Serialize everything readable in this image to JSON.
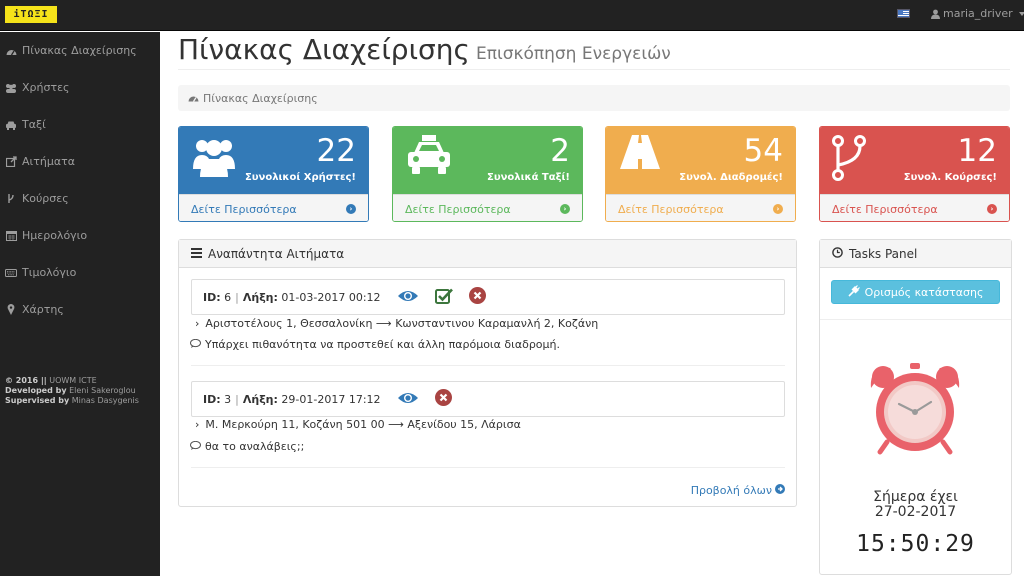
{
  "brand": {
    "logo_text": "iTΩΞI"
  },
  "topbar": {
    "username": "maria_driver"
  },
  "sidebar": {
    "items": [
      {
        "label": "Πίνακας Διαχείρισης",
        "icon": "dashboard-icon"
      },
      {
        "label": "Χρήστες",
        "icon": "users-icon"
      },
      {
        "label": "Ταξί",
        "icon": "taxi-icon"
      },
      {
        "label": "Αιτήματα",
        "icon": "external-link-icon"
      },
      {
        "label": "Κούρσες",
        "icon": "fork-icon"
      },
      {
        "label": "Ημερολόγιο",
        "icon": "calendar-icon"
      },
      {
        "label": "Τιμολόγιο",
        "icon": "keyboard-icon"
      },
      {
        "label": "Χάρτης",
        "icon": "map-marker-icon"
      }
    ],
    "footer": {
      "copyright": "© 2016 ||",
      "org": "UOWM ICTE",
      "developed_label": "Developed by",
      "developer": "Eleni Sakeroglou",
      "supervised_label": "Supervised by",
      "supervisor": "Minas Dasygenis"
    }
  },
  "header": {
    "title": "Πίνακας Διαχείρισης",
    "subtitle": "Επισκόπηση Ενεργειών"
  },
  "breadcrumb": {
    "label": "Πίνακας Διαχείρισης"
  },
  "stats": [
    {
      "value": "22",
      "label": "Συνολικοί Χρήστες!",
      "link": "Δείτε Περισσότερα",
      "icon": "users-icon",
      "color": "#337ab7"
    },
    {
      "value": "2",
      "label": "Συνολικά Ταξί!",
      "link": "Δείτε Περισσότερα",
      "icon": "taxi-icon",
      "color": "#5cb85c"
    },
    {
      "value": "54",
      "label": "Συνολ. Διαδρομές!",
      "link": "Δείτε Περισσότερα",
      "icon": "road-icon",
      "color": "#f0ad4e"
    },
    {
      "value": "12",
      "label": "Συνολ. Κούρσες!",
      "link": "Δείτε Περισσότερα",
      "icon": "fork-icon",
      "color": "#d9534f"
    }
  ],
  "requests": {
    "title": "Αναπάντητα Αιτήματα",
    "id_label": "ID:",
    "expiry_label": "Λήξη:",
    "items": [
      {
        "id": "6",
        "expiry": "01-03-2017 00:12",
        "route": "Αριστοτέλους 1, Θεσσαλονίκη ⟶ Κωνσταντινου Καραμανλή 2, Κοζάνη",
        "comment": "Υπάρχει πιθανότητα να προστεθεί και άλλη παρόμοια διαδρομή."
      },
      {
        "id": "3",
        "expiry": "29-01-2017 17:12",
        "route": "Μ. Μερκούρη 11, Κοζάνη 501 00 ⟶ Αξενίδου 15, Λάρισα",
        "comment": "θα το αναλάβεις;;"
      }
    ],
    "view_all": "Προβολή όλων"
  },
  "tasks": {
    "title": "Tasks Panel",
    "button": "Ορισμός κατάστασης",
    "today_label": "Σήμερα έχει",
    "date": "27-02-2017",
    "time": "15:50:29"
  },
  "colors": {
    "primary": "#337ab7",
    "success": "#5cb85c",
    "warning": "#f0ad4e",
    "danger": "#d9534f",
    "info": "#5bc0de",
    "brand_yellow": "#f5e31a"
  }
}
